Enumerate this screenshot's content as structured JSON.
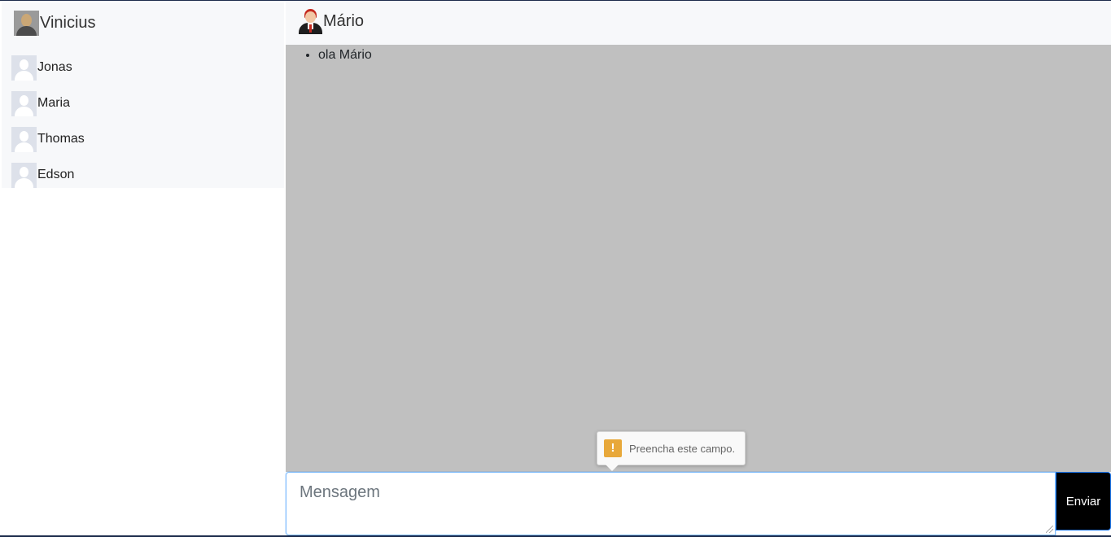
{
  "user": {
    "name": "Vinicius"
  },
  "contacts": [
    {
      "name": "Jonas"
    },
    {
      "name": "Maria"
    },
    {
      "name": "Thomas"
    },
    {
      "name": "Edson"
    }
  ],
  "chat": {
    "peer_name": "Mário",
    "messages": [
      "ola Mário"
    ]
  },
  "compose": {
    "value": "",
    "placeholder": "Mensagem",
    "send_label": "Enviar",
    "validation_message": "Preencha este campo."
  },
  "colors": {
    "sidebar_bg": "#f7f8fa",
    "messages_bg": "#c0c0c0",
    "send_button_bg": "#000000",
    "warning_icon": "#e8a83a"
  },
  "icons": {
    "user_avatar": "user-avatar-icon",
    "contact_avatar": "default-avatar-icon",
    "peer_avatar": "businessman-avatar-icon",
    "warning": "exclamation-icon"
  }
}
